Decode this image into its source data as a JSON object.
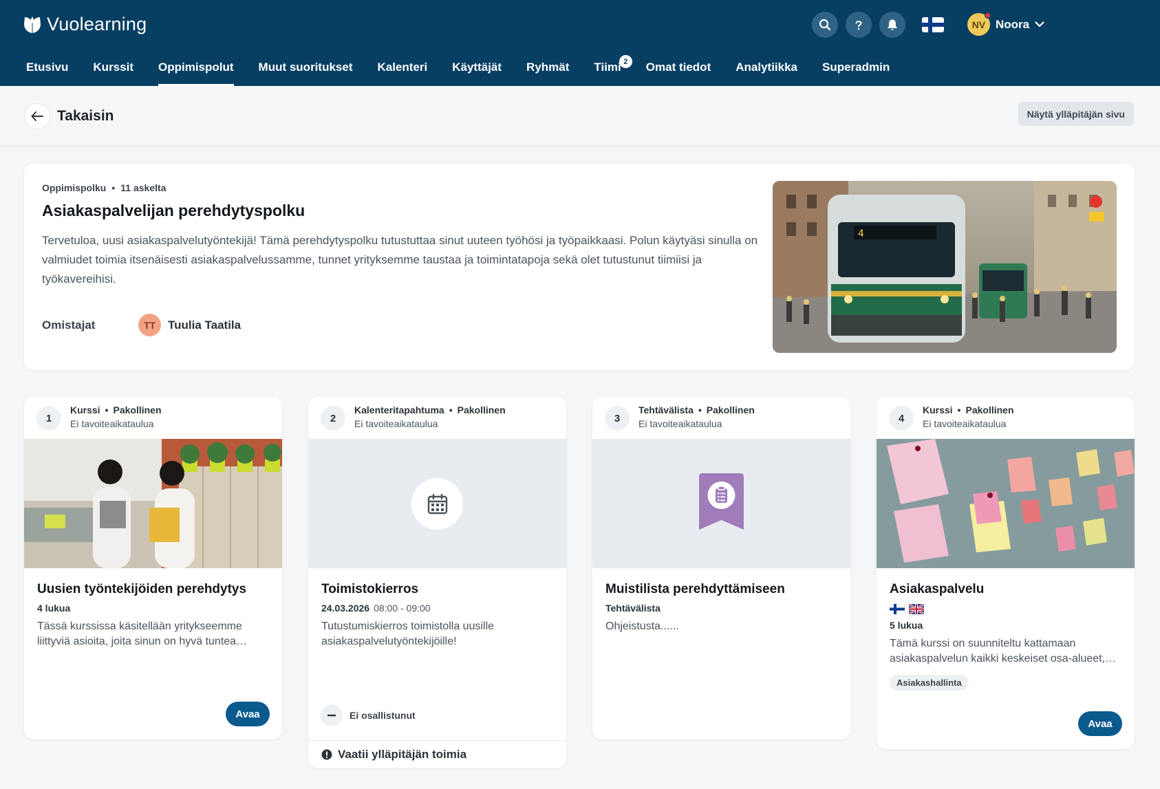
{
  "header": {
    "logo_text": "Vuolearning",
    "user_initials": "NV",
    "user_name": "Noora",
    "nav": [
      {
        "label": "Etusivu"
      },
      {
        "label": "Kurssit"
      },
      {
        "label": "Oppimispolut",
        "active": true
      },
      {
        "label": "Muut suoritukset"
      },
      {
        "label": "Kalenteri"
      },
      {
        "label": "Käyttäjät"
      },
      {
        "label": "Ryhmät"
      },
      {
        "label": "Tiimi",
        "badge": "2"
      },
      {
        "label": "Omat tiedot"
      },
      {
        "label": "Analytiikka"
      },
      {
        "label": "Superadmin"
      }
    ]
  },
  "subheader": {
    "back_label": "Takaisin",
    "admin_button": "Näytä ylläpitäjän sivu"
  },
  "path": {
    "type": "Oppimispolku",
    "steps": "11 askelta",
    "title": "Asiakaspalvelijan perehdytyspolku",
    "description": "Tervetuloa, uusi asiakaspalvelutyöntekijä! Tämä perehdytyspolku tutustuttaa sinut uuteen työhösi ja työpaikkaasi. Polun käytyäsi sinulla on valmiudet toimia itsenäisesti asiakaspalvelussamme, tunnet yrityksemme taustaa ja toimintatapoja sekä olet tutustunut tiimiisi ja työkavereihisi.",
    "owners_label": "Omistajat",
    "owner_initials": "TT",
    "owner_name": "Tuulia Taatila"
  },
  "cards": [
    {
      "num": "1",
      "type": "Kurssi",
      "required": "Pakollinen",
      "schedule": "Ei tavoiteaikataulua",
      "title": "Uusien työntekijöiden perehdytys",
      "info": "4 lukua",
      "desc": "Tässä kurssissa käsitellään yritykseemme liittyviä asioita, joita sinun on hyvä tuntea…",
      "button": "Avaa"
    },
    {
      "num": "2",
      "type": "Kalenteritapahtuma",
      "required": "Pakollinen",
      "schedule": "Ei tavoiteaikataulua",
      "title": "Toimistokierros",
      "date": "24.03.2026",
      "time": "08:00 - 09:00",
      "desc": "Tutustumiskierros toimistolla uusille asiakaspalvelutyöntekijöille!",
      "status": "Ei osallistunut",
      "footer": "Vaatii ylläpitäjän toimia"
    },
    {
      "num": "3",
      "type": "Tehtävälista",
      "required": "Pakollinen",
      "schedule": "Ei tavoiteaikataulua",
      "title": "Muistilista perehdyttämiseen",
      "info": "Tehtävälista",
      "desc": "Ohjeistusta......"
    },
    {
      "num": "4",
      "type": "Kurssi",
      "required": "Pakollinen",
      "schedule": "Ei tavoiteaikataulua",
      "title": "Asiakaspalvelu",
      "info": "5 lukua",
      "desc": "Tämä kurssi on suunniteltu kattamaan asiakaspalvelun kaikki keskeiset osa-alueet,…",
      "tag": "Asiakashallinta",
      "button": "Avaa"
    }
  ],
  "colors": {
    "header_bg": "#073f63",
    "primary_button": "#0a5a8e",
    "page_bg": "#f4f6f8",
    "checklist_accent": "#a07cbb"
  }
}
